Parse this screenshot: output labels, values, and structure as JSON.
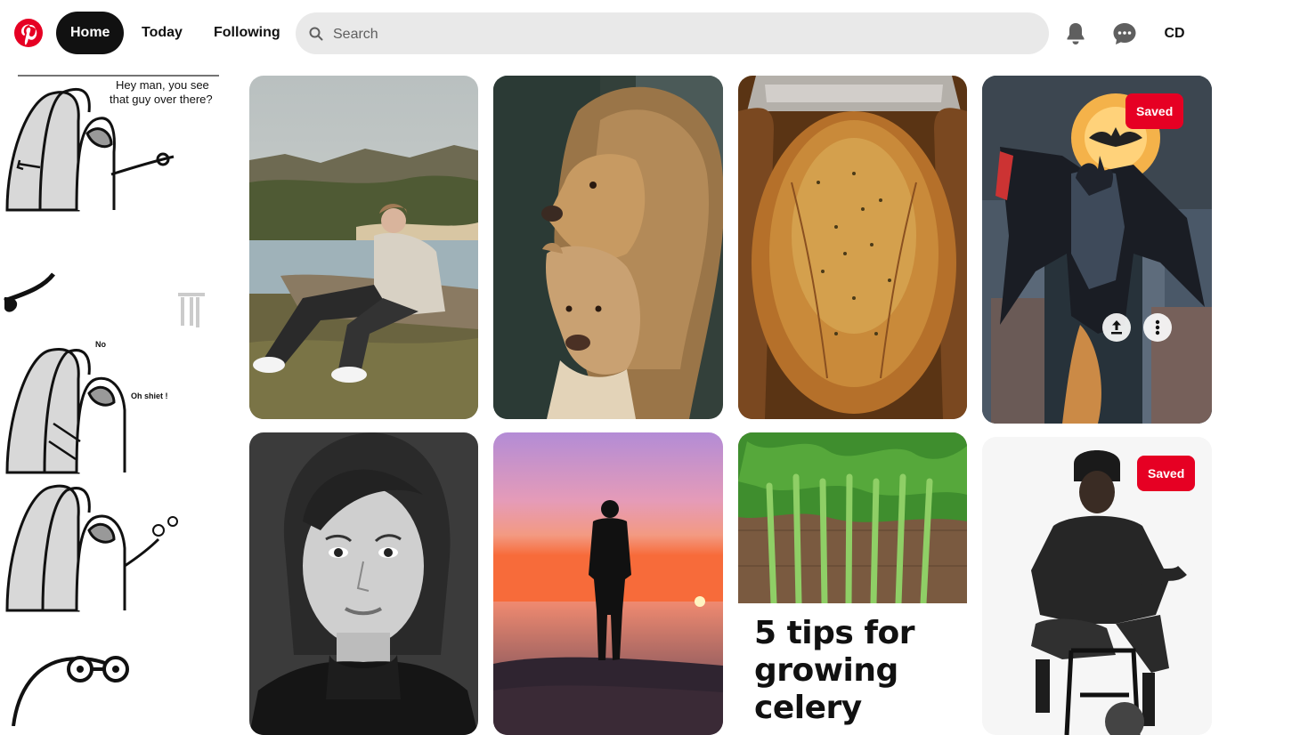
{
  "nav": {
    "home": "Home",
    "today": "Today",
    "following": "Following"
  },
  "search": {
    "placeholder": "Search"
  },
  "user": {
    "initials": "CD"
  },
  "brand_color": "#e60023",
  "comic": {
    "line1": "Hey man, you see",
    "line2": "that guy over there?",
    "reply1": "No",
    "reply2": "Oh shiet !"
  },
  "pins": [
    {
      "subject": "man-by-lake"
    },
    {
      "subject": "lion-and-lioness"
    },
    {
      "subject": "roast-turkey"
    },
    {
      "subject": "batman",
      "saved_label": "Saved"
    },
    {
      "subject": "woman-portrait"
    },
    {
      "subject": "sunset-silhouette"
    },
    {
      "subject": "celery",
      "title_lines": [
        "5 tips for",
        "growing",
        "celery"
      ]
    },
    {
      "subject": "man-on-stool",
      "saved_label": "Saved"
    }
  ]
}
